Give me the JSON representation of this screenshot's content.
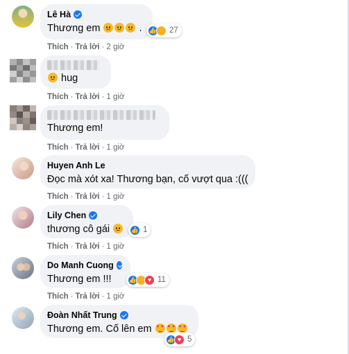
{
  "comments": [
    {
      "name": "Lê Hà",
      "verified": true,
      "text": "Thương em",
      "text_suffix": ".",
      "reaction_count": "27",
      "like": "Thích",
      "reply": "Trả lời",
      "time": "2 giờ",
      "avatar_color": "#e2c64a"
    },
    {
      "name": "",
      "verified": false,
      "text": "hug",
      "reaction_count": "",
      "like": "Thích",
      "reply": "Trả lời",
      "time": "1 giờ",
      "avatar_color": "#9a9a9a"
    },
    {
      "name": "",
      "verified": false,
      "text": "Thương em!",
      "reaction_count": "",
      "like": "Thích",
      "reply": "Trả lời",
      "time": "1 giờ",
      "avatar_color": "#8a7f7a"
    },
    {
      "name": "Huyen Anh Le",
      "verified": false,
      "text": "Đọc mà xót xa! Thương bạn, cố vượt qua :(((",
      "reaction_count": "",
      "like": "Thích",
      "reply": "Trả lời",
      "time": "1 giờ",
      "avatar_color": "#d9b8a8"
    },
    {
      "name": "Lily Chen",
      "verified": true,
      "text": "thương cô gái",
      "reaction_count": "1",
      "like": "Thích",
      "reply": "Trả lời",
      "time": "1 giờ",
      "avatar_color": "#c79aa0"
    },
    {
      "name": "Do Manh Cuong",
      "verified": true,
      "text": "Thương em !!!",
      "reaction_count": "11",
      "like": "Thích",
      "reply": "Trả lời",
      "time": "1 giờ",
      "avatar_color": "#7d8aa0"
    },
    {
      "name": "Đoàn Nhất Trung",
      "verified": true,
      "text": "Thương em. Cố lên em",
      "reaction_count": "5",
      "like": "Thích",
      "reply": "Trả lời",
      "time": "1 giờ",
      "avatar_color": "#a8b8c8"
    }
  ],
  "colors": {
    "bubble_bg": "#f0f2f5",
    "meta_text": "#65676b",
    "like_blue": "#1877f2",
    "love_red": "#f33e58",
    "care_yellow": "#f7b125"
  }
}
